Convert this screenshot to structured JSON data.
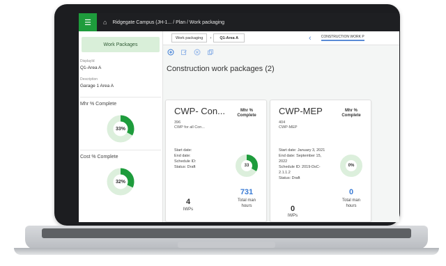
{
  "topbar": {
    "home_icon": "home-icon",
    "breadcrumb": "Ridgegate Campus (JH-1...  /  Plan  /  Work packaging"
  },
  "sidebar": {
    "tab_label": "Work Packages",
    "display_id_label": "DisplayId",
    "display_id_value": "Q1-Area A",
    "description_label": "Description",
    "description_value": "Garage 1 Area A",
    "mhr_title": "Mhr % Complete",
    "mhr_value": "33%",
    "mhr_fraction": 0.33,
    "cost_title": "Cost % Complete",
    "cost_value": "32%",
    "cost_fraction": 0.32
  },
  "main": {
    "tab_pill_1": "Work packaging",
    "tab_pill_2": "Q1-Area A",
    "construction_tab": "CONSTRUCTION WORK P",
    "heading": "Construction work packages (2)"
  },
  "cards": [
    {
      "title": "CWP- Con...",
      "number": "396",
      "desc": "CWP for all Con...",
      "hdr": "Mhr % Complete",
      "start": "Start date:",
      "end": "End date:",
      "schedule": "Schedule ID:",
      "status": "Status: Draft",
      "donut_label": "33",
      "donut_fraction": 0.33,
      "iwp_count": "4",
      "iwp_label": "IWPs",
      "hours": "731",
      "hours_label": "Total man hours"
    },
    {
      "title": "CWP-MEP",
      "number": "404",
      "desc": "CWP-MEP",
      "hdr": "Mhr % Complete",
      "start": "Start date: January 3, 2021",
      "end": "End date: September 15, 2022",
      "schedule": "Schedule ID: 2019-DsC-2.1.1.2",
      "status": "Status: Draft",
      "donut_label": "0%",
      "donut_fraction": 0,
      "iwp_count": "0",
      "iwp_label": "IWPs",
      "hours": "0",
      "hours_label": "Total man hours"
    }
  ],
  "colors": {
    "accent_green": "#1e9c3c",
    "donut_track": "#dcefdc",
    "link_blue": "#3a7bd5"
  }
}
